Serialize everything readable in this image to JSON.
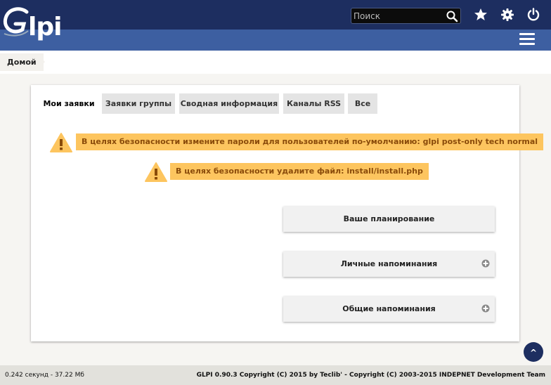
{
  "header": {
    "logo_text": "lpi",
    "search_placeholder": "Поиск",
    "icons": [
      "star-icon",
      "gear-icon",
      "power-icon",
      "menu-icon"
    ]
  },
  "breadcrumb": {
    "home": "Домой"
  },
  "tabs": [
    {
      "label": "Мои заявки",
      "active": true
    },
    {
      "label": "Заявки группы",
      "active": false
    },
    {
      "label": "Сводная информация",
      "active": false
    },
    {
      "label": "Каналы RSS",
      "active": false
    },
    {
      "label": "Все",
      "active": false
    }
  ],
  "warnings": [
    "В целях безопасности измените пароли для пользователей по-умолчанию: glpi post-only tech normal",
    "В целях безопасности удалите файл: install/install.php"
  ],
  "boxes": [
    {
      "title": "Ваше планирование",
      "expandable": false
    },
    {
      "title": "Личные напоминания",
      "expandable": true
    },
    {
      "title": "Общие напоминания",
      "expandable": true
    }
  ],
  "scroll_top_label": "^",
  "footer": {
    "stats": "0.242 секунд - 37.22 Мб",
    "copyright": "GLPI 0.90.3 Copyright (C) 2015 by Teclib' - Copyright (C) 2003-2015 INDEPNET Development Team"
  },
  "colors": {
    "header": "#1d2e60",
    "nav": "#3d5fa1",
    "warning": "#fdc55f",
    "warning_text": "#8a4b0a"
  }
}
